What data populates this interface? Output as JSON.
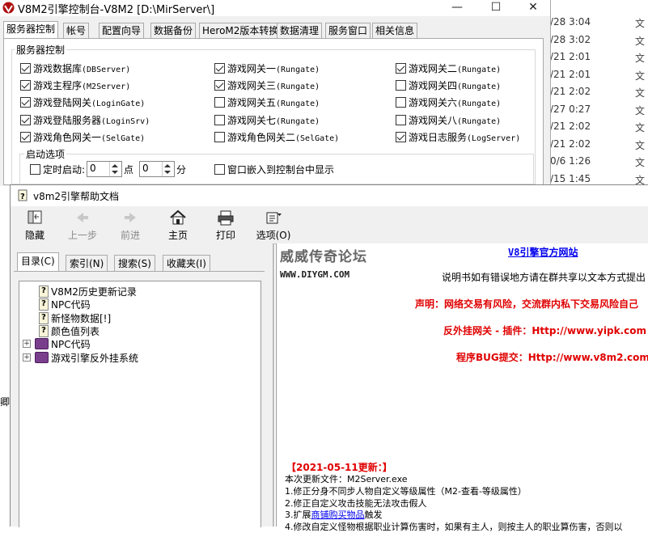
{
  "background": {
    "explorer_rows": [
      {
        "date": "/28 3:04",
        "type": "文"
      },
      {
        "date": "/28 3:02",
        "type": "文"
      },
      {
        "date": "/21 2:01",
        "type": "文"
      },
      {
        "date": "/21 2:01",
        "type": "文"
      },
      {
        "date": "/21 2:02",
        "type": "文"
      },
      {
        "date": "/27 0:27",
        "type": "文"
      },
      {
        "date": "/21 2:02",
        "type": "文"
      },
      {
        "date": "/21 2:02",
        "type": "文"
      },
      {
        "date": "0/6 1:26",
        "type": "文"
      },
      {
        "date": "/15 1:45",
        "type": "文"
      }
    ],
    "left_edge_text": "卿"
  },
  "console": {
    "title": "V8M2引擎控制台-V8M2 [D:\\MirServer\\]",
    "window_buttons": {
      "minimize": "—",
      "maximize": "☐",
      "close": "✕"
    },
    "tabs": [
      "服务器控制",
      "帐号",
      "配置向导",
      "数据备份",
      "HeroM2版本转换",
      "数据清理",
      "服务窗口",
      "相关信息"
    ],
    "active_tab": "服务器控制",
    "group_title": "服务器控制",
    "servers": [
      {
        "label": "游戏数据库",
        "code": "(DBServer)",
        "checked": true
      },
      {
        "label": "游戏网关一",
        "code": "(Rungate)",
        "checked": true
      },
      {
        "label": "游戏网关二",
        "code": "(Rungate)",
        "checked": true
      },
      {
        "label": "游戏主程序",
        "code": "(M2Server)",
        "checked": true
      },
      {
        "label": "游戏网关三",
        "code": "(Rungate)",
        "checked": true
      },
      {
        "label": "游戏网关四",
        "code": "(Rungate)",
        "checked": false
      },
      {
        "label": "游戏登陆网关",
        "code": "(LoginGate)",
        "checked": true
      },
      {
        "label": "游戏网关五",
        "code": "(Rungate)",
        "checked": false
      },
      {
        "label": "游戏网关六",
        "code": "(Rungate)",
        "checked": false
      },
      {
        "label": "游戏登陆服务器",
        "code": "(LoginSrv)",
        "checked": true
      },
      {
        "label": "游戏网关七",
        "code": "(Rungate)",
        "checked": false
      },
      {
        "label": "游戏网关八",
        "code": "(Rungate)",
        "checked": false
      },
      {
        "label": "游戏角色网关一",
        "code": "(SelGate)",
        "checked": true
      },
      {
        "label": "游戏角色网关二",
        "code": "(SelGate)",
        "checked": false
      },
      {
        "label": "游戏日志服务",
        "code": "(LogServer)",
        "checked": true
      }
    ],
    "startup": {
      "group_title": "启动选项",
      "timed_start_label": "定时启动:",
      "timed_start_checked": false,
      "hour_value": "0",
      "hour_unit": "点",
      "minute_value": "0",
      "minute_unit": "分",
      "embed_label": "窗口嵌入到控制台中显示",
      "embed_checked": false
    }
  },
  "help": {
    "title": "v8m2引擎帮助文档",
    "toolbar": [
      {
        "label": "隐藏",
        "icon": "hide-icon",
        "enabled": true
      },
      {
        "label": "上一步",
        "icon": "back-arrow-icon",
        "enabled": false
      },
      {
        "label": "前进",
        "icon": "forward-arrow-icon",
        "enabled": false
      },
      {
        "label": "主页",
        "icon": "home-icon",
        "enabled": true
      },
      {
        "label": "打印",
        "icon": "printer-icon",
        "enabled": true
      },
      {
        "label": "选项(O)",
        "icon": "options-icon",
        "enabled": true
      }
    ],
    "nav_tabs": [
      "目录(C)",
      "索引(N)",
      "搜索(S)",
      "收藏夹(I)"
    ],
    "active_nav_tab": "目录(C)",
    "tree": [
      {
        "label": "V8M2历史更新记录",
        "kind": "page"
      },
      {
        "label": "NPC代码",
        "kind": "page"
      },
      {
        "label": "新怪物数据[!]",
        "kind": "page"
      },
      {
        "label": "颜色值列表",
        "kind": "page"
      },
      {
        "label": "NPC代码",
        "kind": "book"
      },
      {
        "label": "游戏引擎反外挂系统",
        "kind": "book"
      }
    ],
    "content": {
      "logo_text": "威威传奇论坛",
      "logo_url": "WWW.DIYGM.COM",
      "official_link": "V8引擎官方网站",
      "notice": "说明书如有错误地方请在群共享以文本方式提出",
      "disclaimer": "声明：网络交易有风险，交流群内私下交易风险自己",
      "anticheat": "反外挂网关 - 插件：Http://www.yipk.com",
      "bug_report": "程序BUG提交：Http://www.v8m2.com",
      "update_header": "【2021-05-11更新：】",
      "update_file": "本次更新文件：M2Server.exe",
      "update_items": [
        "1.修正分身不同步人物自定义等级属性（M2-查看-等级属性）",
        "2.修正自定义攻击技能无法攻击假人",
        "3.扩展商铺购买物品触发",
        "4.修改自定义怪物根据职业计算伤害时，如果有主人，则按主人的职业算伤害，否则以"
      ],
      "item3_link": "商铺购买物品"
    },
    "colors": {
      "red": "#e00000",
      "blue": "#0000cc",
      "link": "#0000ee"
    }
  }
}
